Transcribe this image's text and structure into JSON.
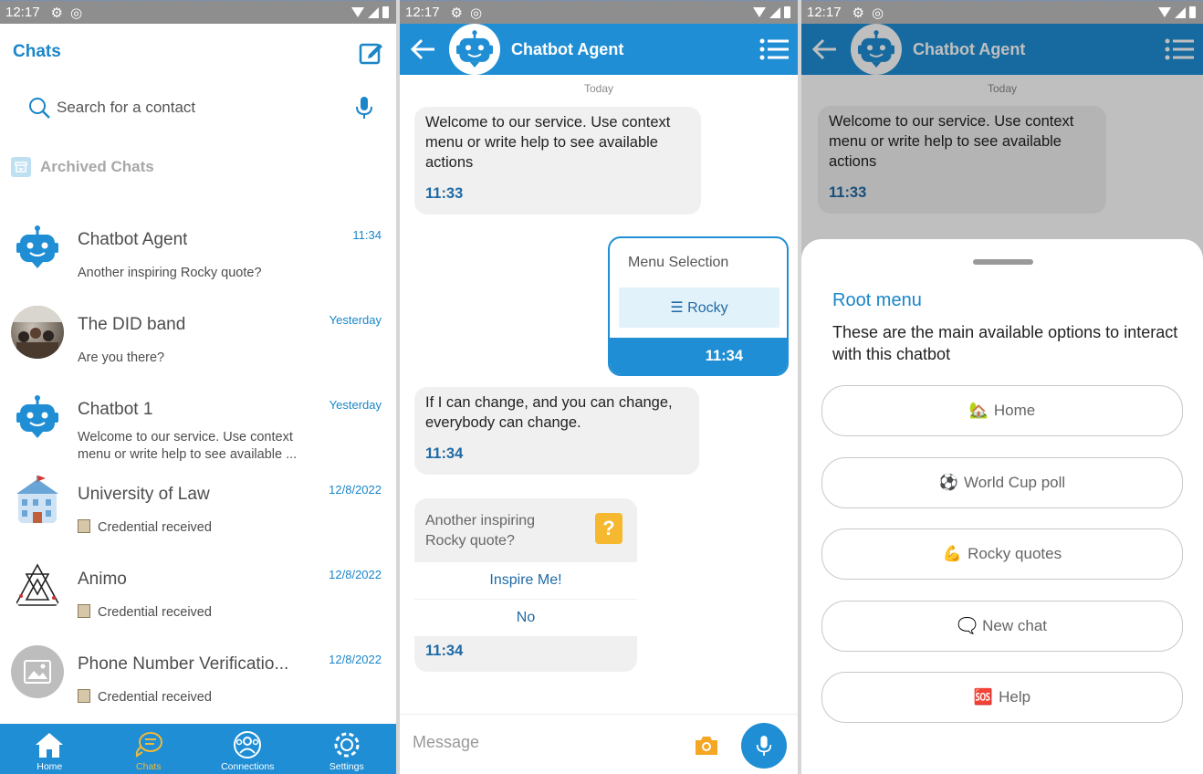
{
  "status": {
    "time": "12:17"
  },
  "screen1": {
    "title": "Chats",
    "search": {
      "placeholder": "Search for a contact"
    },
    "archived_label": "Archived Chats",
    "chats": [
      {
        "name": "Chatbot Agent",
        "time": "11:34",
        "preview": "Another inspiring Rocky quote?"
      },
      {
        "name": "The DID band",
        "time": "Yesterday",
        "preview": "Are you there?"
      },
      {
        "name": "Chatbot 1",
        "time": "Yesterday",
        "preview": "Welcome to our service. Use context menu or write help to see available ..."
      },
      {
        "name": "University of Law",
        "time": "12/8/2022",
        "preview": "Credential received"
      },
      {
        "name": "Animo",
        "time": "12/8/2022",
        "preview": "Credential received"
      },
      {
        "name": "Phone Number Verificatio...",
        "time": "12/8/2022",
        "preview": "Credential received"
      }
    ],
    "tabs": [
      {
        "label": "Home"
      },
      {
        "label": "Chats"
      },
      {
        "label": "Connections"
      },
      {
        "label": "Settings"
      }
    ]
  },
  "screen2": {
    "header_title": "Chatbot Agent",
    "day": "Today",
    "welcome": {
      "text": "Welcome to our service. Use context menu or write help to see available actions",
      "time": "11:33"
    },
    "menu_selection": {
      "title": "Menu Selection",
      "option": "☰ Rocky",
      "time": "11:34"
    },
    "quote": {
      "text": "If I can change, and you can change, everybody can change.",
      "time": "11:34"
    },
    "question": {
      "text": "Another inspiring Rocky quote?",
      "icon": "?",
      "options": [
        "Inspire Me!",
        "No"
      ],
      "time": "11:34"
    },
    "composer": {
      "placeholder": "Message"
    }
  },
  "screen3": {
    "header_title": "Chatbot Agent",
    "day": "Today",
    "welcome": {
      "text": "Welcome to our service. Use context menu or write help to see available actions",
      "time": "11:33"
    },
    "sheet": {
      "title": "Root menu",
      "description": "These are the main available options to interact with this chatbot",
      "options": [
        {
          "emoji": "🏡",
          "label": "Home"
        },
        {
          "emoji": "⚽",
          "label": "World Cup poll"
        },
        {
          "emoji": "💪",
          "label": "Rocky quotes"
        },
        {
          "emoji": "🗨️",
          "label": "New chat"
        },
        {
          "emoji": "🆘",
          "label": "Help"
        }
      ]
    }
  },
  "colors": {
    "brand_blue": "#1f8ed4",
    "accent_yellow": "#f0b93a",
    "link_blue": "#1f6aa5"
  }
}
